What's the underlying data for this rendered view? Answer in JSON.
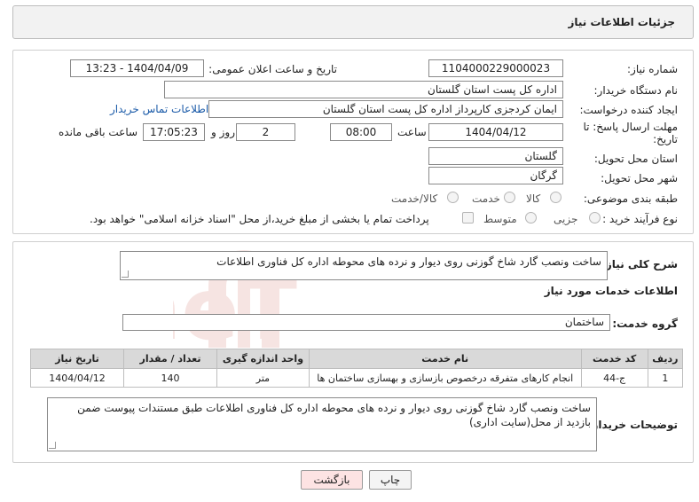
{
  "header": {
    "title": "جزئیات اطلاعات نیاز"
  },
  "form": {
    "need_number_label": "شماره نیاز:",
    "need_number": "1104000229000023",
    "announce_label": "تاریخ و ساعت اعلان عمومی:",
    "announce_value": "1404/04/09 - 13:23",
    "buyer_org_label": "نام دستگاه خریدار:",
    "buyer_org": "اداره کل پست استان گلستان",
    "requester_label": "ایجاد کننده درخواست:",
    "requester": "ایمان کردجزی کارپرداز اداره کل پست استان گلستان",
    "contact_link": "اطلاعات تماس خریدار",
    "deadline_label_1": "مهلت ارسال پاسخ: تا",
    "deadline_label_2": "تاریخ:",
    "deadline_date": "1404/04/12",
    "time_label": "ساعت",
    "deadline_time": "08:00",
    "days_value": "2",
    "days_label": "روز و",
    "remaining_time": "17:05:23",
    "remaining_label": "ساعت باقی مانده",
    "province_label": "استان محل تحویل:",
    "province": "گلستان",
    "city_label": "شهر محل تحویل:",
    "city": "گرگان",
    "category_label": "طبقه بندی موضوعی:",
    "category_options": [
      "کالا",
      "خدمت",
      "کالا/خدمت"
    ],
    "process_label": "نوع فرآیند خرید :",
    "process_options": [
      "جزیی",
      "متوسط"
    ],
    "payment_note": "پرداخت تمام یا بخشی از مبلغ خرید،از محل \"اسناد خزانه اسلامی\" خواهد بود."
  },
  "details": {
    "summary_label": "شرح کلی نیاز:",
    "summary": "ساخت ونصب گارد شاخ گوزنی روی دیوار و نرده های محوطه اداره کل فناوری اطلاعات",
    "services_title": "اطلاعات خدمات مورد نیاز",
    "group_label": "گروه خدمت:",
    "group": "ساختمان",
    "table": {
      "headers": [
        "ردیف",
        "کد خدمت",
        "نام خدمت",
        "واحد اندازه گیری",
        "تعداد / مقدار",
        "تاریخ نیاز"
      ],
      "rows": [
        [
          "1",
          "ج-44",
          "انجام کارهای متفرقه درخصوص بازسازی و بهسازی ساختمان ها",
          "متر",
          "140",
          "1404/04/12"
        ]
      ]
    },
    "buyer_notes_label": "توضیحات خریدار:",
    "buyer_notes": "ساخت ونصب گارد شاخ گوزنی روی دیوار و نرده های محوطه اداره کل فناوری اطلاعات طبق مستندات  پیوست ضمن بازدید از محل(سایت اداری)"
  },
  "buttons": {
    "print": "چاپ",
    "back": "بازگشت"
  },
  "watermark": {
    "text": "AriaTender.neT"
  },
  "colors": {
    "link": "#1a5aa8",
    "back_button_bg": "#fde3e3",
    "watermark": "#c0392b"
  }
}
